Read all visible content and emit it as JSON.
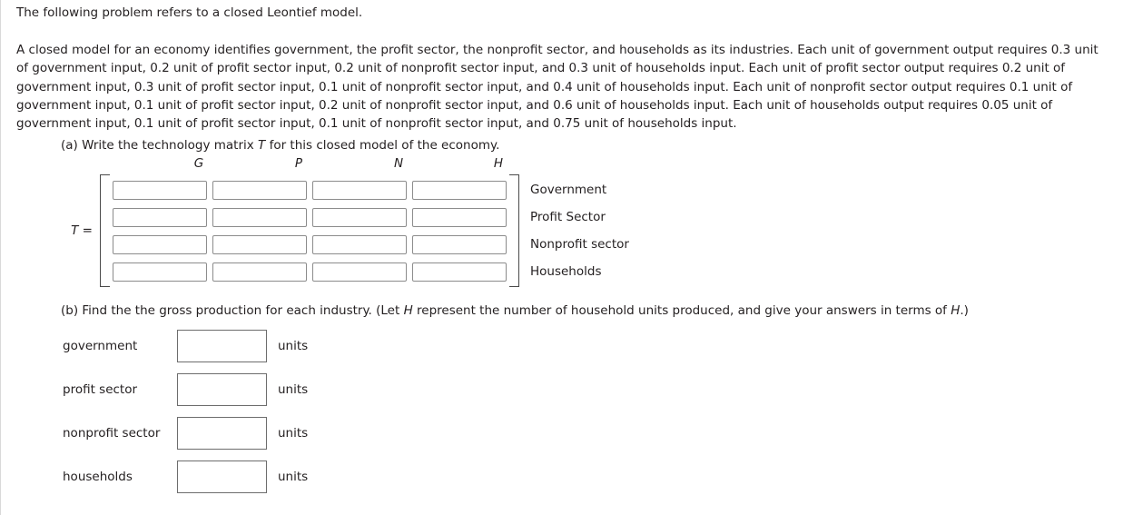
{
  "intro": {
    "text": "The following problem refers to a closed Leontief model."
  },
  "problem": {
    "paragraph": "A closed model for an economy identifies government, the profit sector, the nonprofit sector, and households as its industries. Each unit of government output requires 0.3 unit of government input, 0.2 unit of profit sector input, 0.2 unit of nonprofit sector input, and 0.3 unit of households input. Each unit of profit sector output requires 0.2 unit of government input, 0.3 unit of profit sector input, 0.1 unit of nonprofit sector input, and 0.4 unit of households input. Each unit of nonprofit sector output requires 0.1 unit of government input, 0.1 unit of profit sector input, 0.2 unit of nonprofit sector input, and 0.6 unit of households input. Each unit of households output requires 0.05 unit of government input, 0.1 unit of profit sector input, 0.1 unit of nonprofit sector input, and 0.75 unit of households input."
  },
  "part_a": {
    "prompt_before": "(a) Write the technology matrix ",
    "prompt_italic": "T",
    "prompt_after": " for this closed model of the economy.",
    "matrix_label_italic": "T",
    "matrix_label_after": " =",
    "column_headers": [
      "G",
      "P",
      "N",
      "H"
    ],
    "row_labels": [
      "Government",
      "Profit Sector",
      "Nonprofit sector",
      "Households"
    ],
    "cells": [
      [
        "",
        "",
        "",
        ""
      ],
      [
        "",
        "",
        "",
        ""
      ],
      [
        "",
        "",
        "",
        ""
      ],
      [
        "",
        "",
        "",
        ""
      ]
    ],
    "cell_placeholder": ""
  },
  "part_b": {
    "prompt_before": "(b) Find the the gross production for each industry. (Let ",
    "prompt_italic_1": "H",
    "prompt_middle": " represent the number of household units produced, and give your answers in terms of ",
    "prompt_italic_2": "H",
    "prompt_after": ".)",
    "rows": [
      {
        "label": "government",
        "value": "",
        "units": "units"
      },
      {
        "label": "profit sector",
        "value": "",
        "units": "units"
      },
      {
        "label": "nonprofit sector",
        "value": "",
        "units": "units"
      },
      {
        "label": "households",
        "value": "",
        "units": "units"
      }
    ]
  },
  "colors": {
    "text": "#231f20",
    "input_border": "#8c8c8c",
    "answer_input_border": "#6d6d6d",
    "bracket": "#4a4a4a",
    "page_border": "#d9d9d9",
    "background": "#ffffff"
  }
}
